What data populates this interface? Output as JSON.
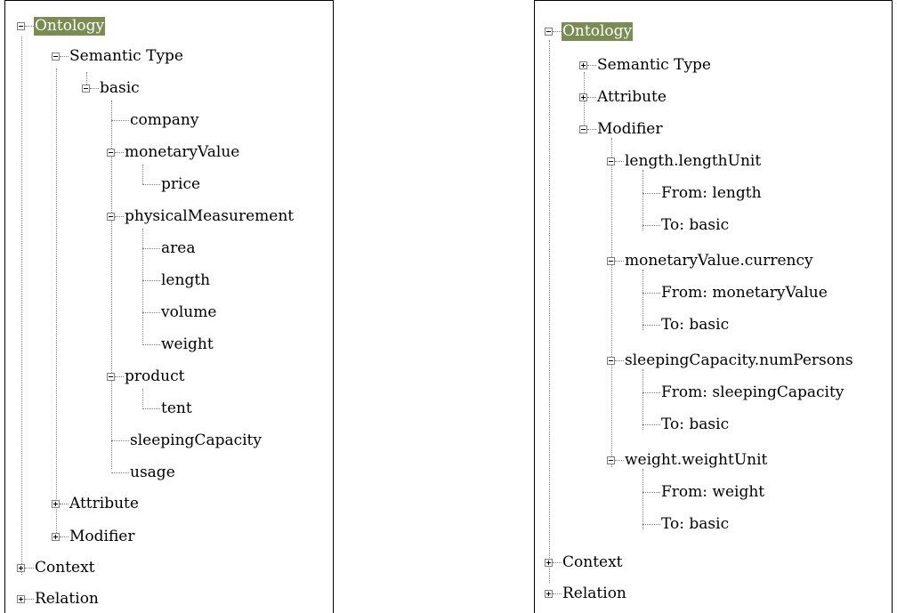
{
  "left_tree": {
    "root": "Ontology",
    "semantic_type": "Semantic Type",
    "basic": "basic",
    "company": "company",
    "monetary_value": "monetaryValue",
    "price": "price",
    "physical_measurement": "physicalMeasurement",
    "area": "area",
    "length": "length",
    "volume": "volume",
    "weight": "weight",
    "product": "product",
    "tent": "tent",
    "sleeping_capacity": "sleepingCapacity",
    "usage": "usage",
    "attribute": "Attribute",
    "modifier": "Modifier",
    "context": "Context",
    "relation": "Relation"
  },
  "right_tree": {
    "root": "Ontology",
    "semantic_type": "Semantic Type",
    "attribute": "Attribute",
    "modifier": "Modifier",
    "length_unit": "length.lengthUnit",
    "length_unit_from": "From: length",
    "length_unit_to": "To: basic",
    "currency": "monetaryValue.currency",
    "currency_from": "From: monetaryValue",
    "currency_to": "To: basic",
    "num_persons": "sleepingCapacity.numPersons",
    "num_persons_from": "From: sleepingCapacity",
    "num_persons_to": "To: basic",
    "weight_unit": "weight.weightUnit",
    "weight_unit_from": "From: weight",
    "weight_unit_to": "To: basic",
    "context": "Context",
    "relation": "Relation"
  },
  "colors": {
    "selection": "#7a8c54",
    "connector": "#808080"
  }
}
